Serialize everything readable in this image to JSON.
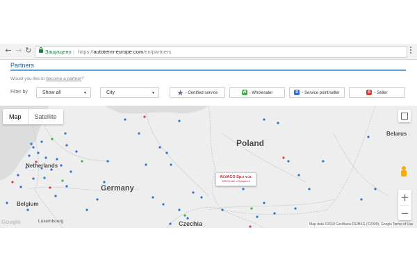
{
  "browser": {
    "back_icon": "back-arrow-icon",
    "forward_icon": "forward-arrow-icon",
    "reload_icon": "reload-icon",
    "secure_label": "Защищено",
    "url_scheme": "https://",
    "url_host": "autoterm-europe.com",
    "url_path": "/en/partners",
    "menu_icon": "kebab-menu-icon"
  },
  "page": {
    "title": "Partners",
    "become_prefix": "Would you like to ",
    "become_link": "become a partner",
    "become_suffix": "?",
    "filter_label": "Filter by"
  },
  "filters": {
    "type_value": "Show all",
    "city_value": "City"
  },
  "legend": {
    "certified": "- Certified service",
    "wholesaler_badge": "W",
    "wholesaler": "- Wholesaler",
    "service_badge": "R",
    "service": "- Service point/seller",
    "seller_badge": "S",
    "seller": "- Seller"
  },
  "colors": {
    "wholesaler": "#3fae49",
    "service": "#2f6fd3",
    "seller": "#d93c3c",
    "accent": "#5ba3d9"
  },
  "map": {
    "type_map": "Map",
    "type_satellite": "Satellite",
    "labels": {
      "poland": "Poland",
      "germany": "Germany",
      "netherlands": "Netherlands",
      "belgium": "Belgium",
      "belarus": "Belarus",
      "czechia": "Czechia",
      "luxembourg": "Luxembourg"
    },
    "popup_name": "ALVACO Sp.z o.o.",
    "popup_address": "WROCŁAW ul.Rybajera,8",
    "zoom_in": "+",
    "zoom_out": "−",
    "google_logo": "Google",
    "attribution": "Map data ©2018 GeoBasis-DE/BKG (©2009), Google",
    "terms": "Terms of Use"
  }
}
